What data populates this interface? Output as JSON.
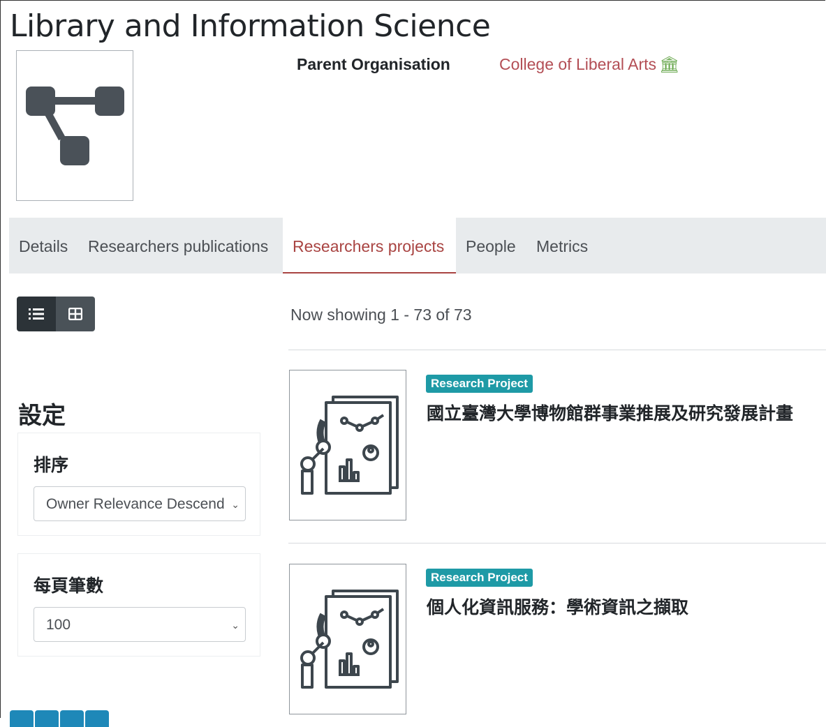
{
  "header": {
    "title": "Library and Information Science",
    "parent_label": "Parent Organisation",
    "parent_link": "College of Liberal Arts",
    "parent_icon": "🏛"
  },
  "tabs": [
    {
      "label": "Details"
    },
    {
      "label": "Researchers publications"
    },
    {
      "label": "Researchers projects"
    },
    {
      "label": "People"
    },
    {
      "label": "Metrics"
    }
  ],
  "view_toggle": {
    "list_icon": "☰",
    "grid_icon": "⊞"
  },
  "results": {
    "showing": "Now showing 1 - 73 of 73"
  },
  "settings": {
    "title": "設定",
    "sort_label": "排序",
    "sort_value": "Owner Relevance Descend",
    "per_page_label": "每頁筆數",
    "per_page_value": "100"
  },
  "projects": [
    {
      "badge": "Research Project",
      "title": "國立臺灣大學博物館群事業推展及研究發展計畫"
    },
    {
      "badge": "Research Project",
      "title": "個人化資訊服務：學術資訊之擷取"
    }
  ],
  "colors": {
    "accent": "#a94442",
    "badge": "#1e9aa6",
    "link": "#b34e55"
  }
}
